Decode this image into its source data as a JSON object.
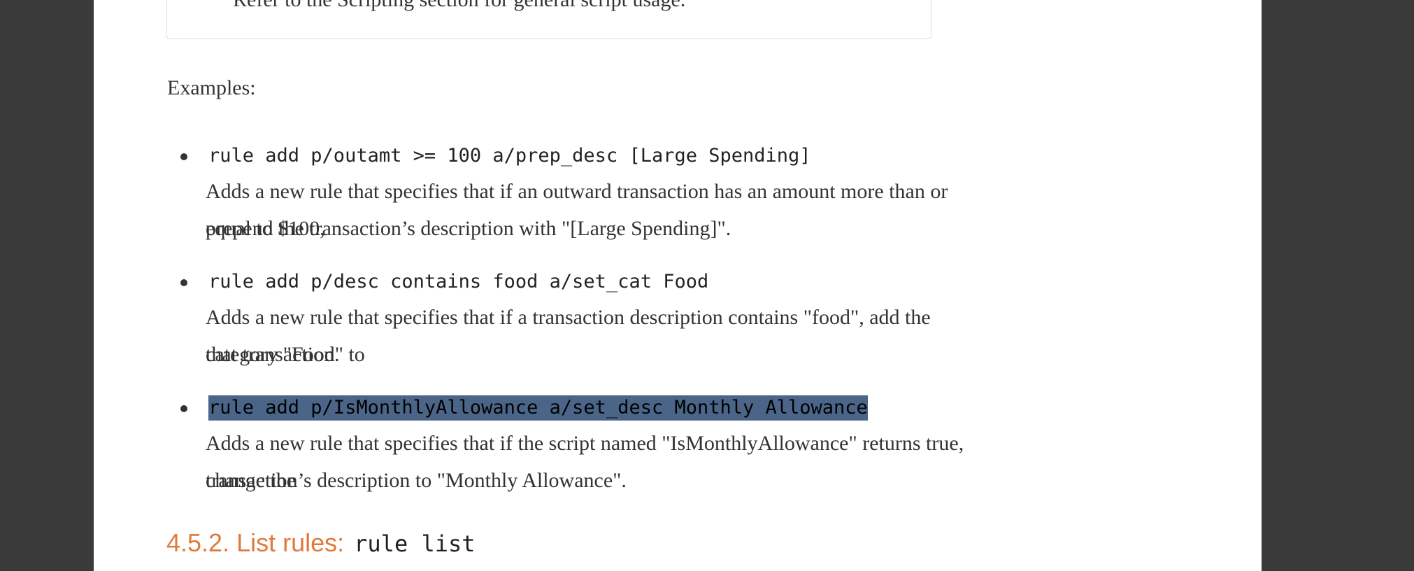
{
  "note": {
    "text": "Refer to the Scripting section for general script usage."
  },
  "examples_label": "Examples:",
  "examples": [
    {
      "command": "rule add p/outamt >= 100 a/prep_desc [Large Spending]",
      "description_line1": "Adds a new rule that specifies that if an outward transaction has an amount more than or equal to $100,",
      "description_line2": "prepend the transaction’s description with \"[Large Spending]\"."
    },
    {
      "command": "rule add p/desc contains food a/set_cat Food",
      "description_line1": "Adds a new rule that specifies that if a transaction description contains \"food\", add the category \"Food\" to",
      "description_line2": "that transaction."
    },
    {
      "command": "rule add p/IsMonthlyAllowance a/set_desc Monthly Allowance",
      "description_line1": "Adds a new rule that specifies that if the script named \"IsMonthlyAllowance\" returns true, change the",
      "description_line2": "transaction’s description to \"Monthly Allowance\"."
    }
  ],
  "section": {
    "title": "4.5.2. List rules:",
    "command": "rule list"
  },
  "colors": {
    "heading": "#e07a3b",
    "selection": "#4a6587",
    "background": "#3a3a3a"
  }
}
